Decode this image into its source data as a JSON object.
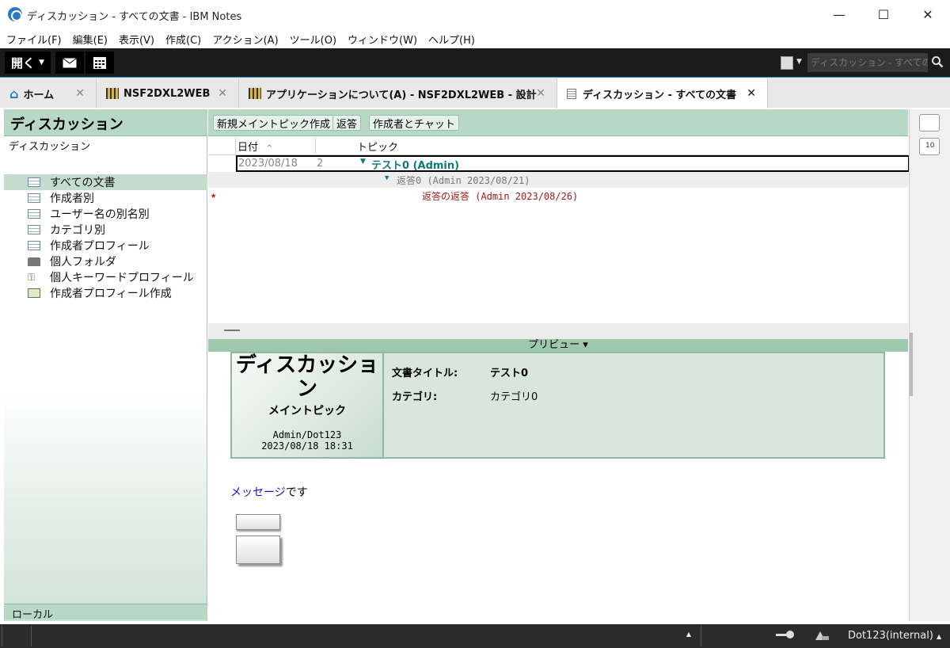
{
  "window": {
    "title": "ディスカッション - すべての文書 - IBM Notes",
    "minimize": "—",
    "maximize": "☐",
    "close": "✕"
  },
  "menu": [
    "ファイル(F)",
    "編集(E)",
    "表示(V)",
    "作成(C)",
    "アクション(A)",
    "ツール(O)",
    "ウィンドウ(W)",
    "ヘルプ(H)"
  ],
  "toolbar": {
    "open_label": "開く",
    "mail_icon": "envelope-icon",
    "calendar_icon": "calendar-icon",
    "search_placeholder": "ディスカッション - すべての文"
  },
  "tabs": [
    {
      "label": "ホーム",
      "icon": "home-icon",
      "close": "✕"
    },
    {
      "label": "NSF2DXL2WEB",
      "icon": "database-icon",
      "close": "✕"
    },
    {
      "label": "アプリケーションについて(A) - NSF2DXL2WEB - 設計",
      "icon": "database-icon",
      "close": "✕"
    },
    {
      "label": "ディスカッション - すべての文書",
      "icon": "document-icon",
      "close": "✕"
    }
  ],
  "navigator": {
    "title": "ディスカッション",
    "subtitle": "ディスカッション",
    "items": [
      {
        "label": "すべての文書"
      },
      {
        "label": "作成者別"
      },
      {
        "label": "ユーザー名の別名別"
      },
      {
        "label": "カテゴリ別"
      },
      {
        "label": "作成者プロフィール"
      },
      {
        "label": "個人フォルダ"
      },
      {
        "label": "個人キーワードプロフィール"
      },
      {
        "label": "作成者プロフィール作成"
      }
    ],
    "footer": "ローカル"
  },
  "actions": [
    "新規メイントピック作成",
    "返答",
    "作成者とチャット"
  ],
  "view": {
    "columns": [
      "日付",
      "トピック"
    ],
    "rows": [
      {
        "date": "2023/08/18",
        "count": "2",
        "topic": "テスト0 (Admin)"
      },
      {
        "reply": "返答0 (Admin 2023/08/21)"
      },
      {
        "unread_mark": "★",
        "reply": "返答の返答 (Admin 2023/08/26)"
      }
    ]
  },
  "preview": {
    "bar_label": "プリビュー ▾",
    "big_title": "ディスカッション",
    "type": "メイントピック",
    "author": "Admin/Dot123",
    "datetime": "2023/08/18 18:31",
    "doc_title_label": "文書タイトル:",
    "doc_title_value": "テスト0",
    "category_label": "カテゴリ:",
    "category_value": "カテゴリ0",
    "body_link": "メッセージ",
    "body_text": "です"
  },
  "status": {
    "user": "Dot123(internal)",
    "up": "▲"
  },
  "colors": {
    "accent_green": "#b6d8c4",
    "topic_teal": "#0b7a78",
    "reply_gray": "#777777",
    "unread_red": "#a01818",
    "link_blue": "#1a0dcc"
  }
}
